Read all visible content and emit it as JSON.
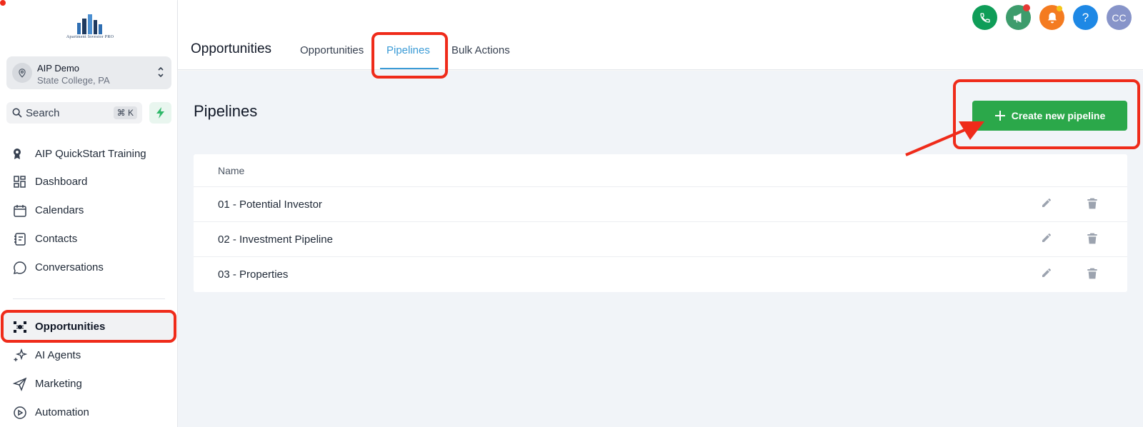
{
  "brand": {
    "logo_text": "Apartment Investor PRO"
  },
  "account": {
    "name": "AIP Demo",
    "location": "State College, PA"
  },
  "search": {
    "label": "Search",
    "shortcut": "⌘ K"
  },
  "sidebar": {
    "items": [
      {
        "label": "AIP QuickStart Training",
        "icon": "award-icon"
      },
      {
        "label": "Dashboard",
        "icon": "grid-icon"
      },
      {
        "label": "Calendars",
        "icon": "calendar-icon"
      },
      {
        "label": "Contacts",
        "icon": "contacts-book-icon"
      },
      {
        "label": "Conversations",
        "icon": "chat-bubble-icon"
      },
      {
        "label": "Opportunities",
        "icon": "opportunities-icon",
        "active": true
      },
      {
        "label": "AI Agents",
        "icon": "sparkle-icon"
      },
      {
        "label": "Marketing",
        "icon": "send-icon"
      },
      {
        "label": "Automation",
        "icon": "automation-icon"
      }
    ]
  },
  "header": {
    "title": "Opportunities",
    "tabs": [
      {
        "label": "Opportunities"
      },
      {
        "label": "Pipelines",
        "active": true
      },
      {
        "label": "Bulk Actions"
      }
    ],
    "avatar_initials": "CC",
    "help_label": "?"
  },
  "main": {
    "title": "Pipelines",
    "create_button_label": "Create new pipeline",
    "table": {
      "column_header": "Name",
      "rows": [
        "01 - Potential Investor",
        "02 - Investment Pipeline",
        "03 - Properties"
      ]
    }
  },
  "colors": {
    "accent": "#3b9bd6",
    "create_button": "#2ba84a",
    "annotation": "#ef2b1a",
    "phone": "#0f9d58",
    "megaphone": "#3d9c6c",
    "bell": "#f47b20",
    "help": "#1e88e5",
    "avatar": "#8794c9"
  }
}
